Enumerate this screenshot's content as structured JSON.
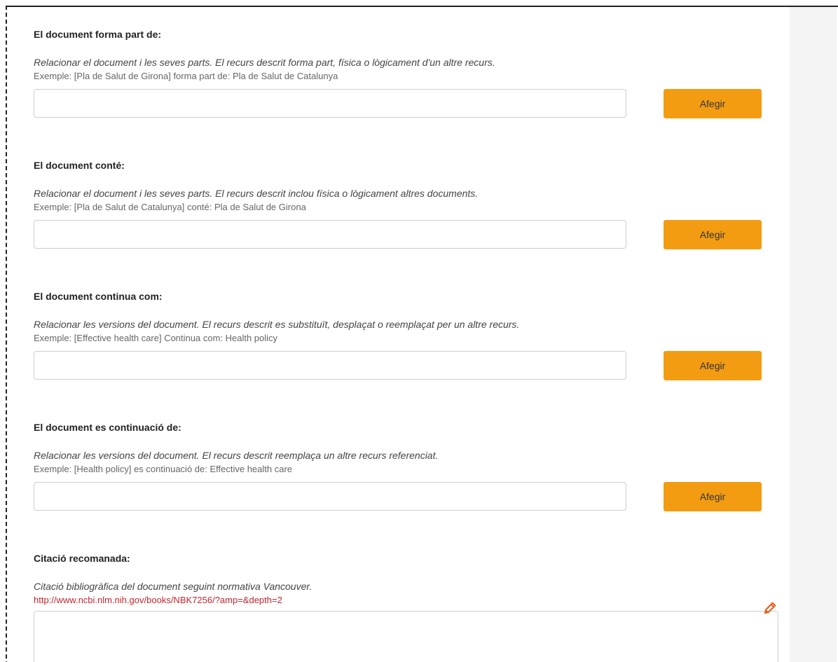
{
  "sections": [
    {
      "title": "El document forma part de:",
      "description": "Relacionar el document i les seves parts. El recurs descrit forma part, física o lògicament d'un altre recurs.",
      "example": "Exemple: [Pla de Salut de Girona] forma part de: Pla de Salut de Catalunya",
      "input_value": "",
      "button_label": "Afegir"
    },
    {
      "title": "El document conté:",
      "description": "Relacionar el document i les seves parts. El recurs descrit inclou física o lògicament altres documents.",
      "example": "Exemple: [Pla de Salut de Catalunya] conté: Pla de Salut de Girona",
      "input_value": "",
      "button_label": "Afegir"
    },
    {
      "title": "El document continua com:",
      "description": "Relacionar les versions del document. El recurs descrit es substituït, desplaçat o reemplaçat per un altre recurs.",
      "example": "Exemple: [Effective health care] Continua com: Health policy",
      "input_value": "",
      "button_label": "Afegir"
    },
    {
      "title": "El document es continuació de:",
      "description": "Relacionar les versions del document. El recurs descrit reemplaça un altre recurs referenciat.",
      "example": "Exemple: [Health policy] es continuació de: Effective health care",
      "input_value": "",
      "button_label": "Afegir"
    }
  ],
  "citation": {
    "title": "Citació recomanada:",
    "description": "Citació bibliogràfica del document seguint normativa Vancouver.",
    "url": "http://www.ncbi.nlm.nih.gov/books/NBK7256/?amp=&depth=2",
    "value": "",
    "edit_icon": "pencil-icon"
  },
  "colors": {
    "accent": "#f39c12",
    "link": "#c4262e",
    "edit_icon": "#e8601c"
  }
}
